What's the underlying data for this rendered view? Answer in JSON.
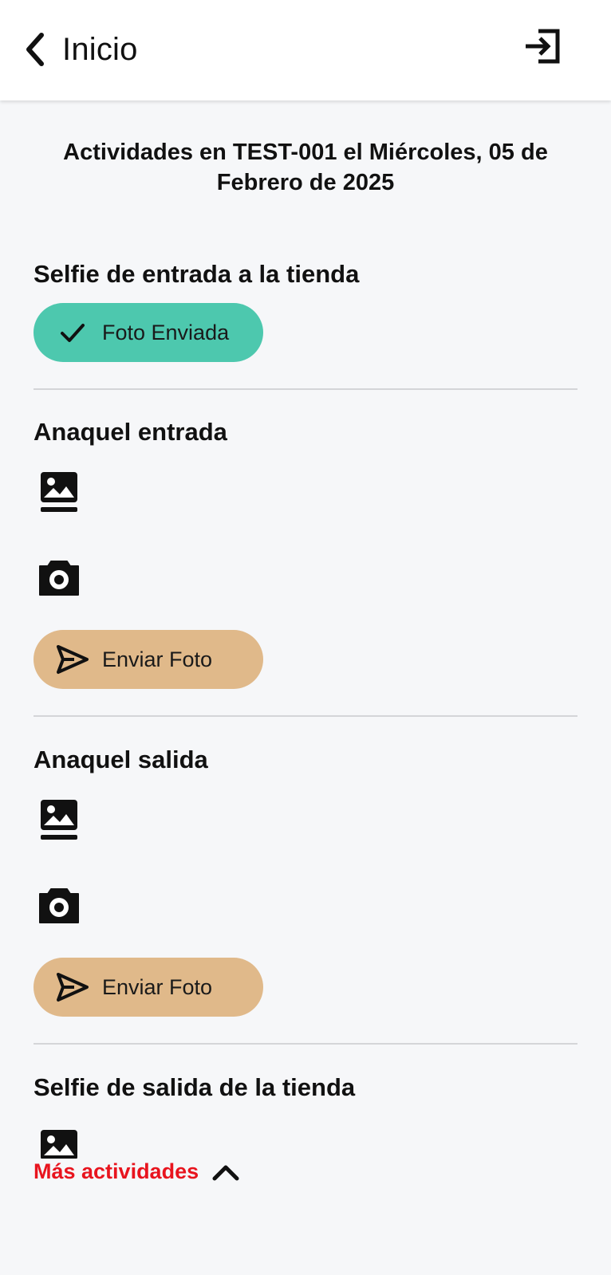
{
  "header": {
    "title": "Inicio",
    "back_icon": "chevron-left-icon",
    "logout_icon": "login-arrow-icon"
  },
  "heading": "Actividades en TEST-001 el Miércoles, 05 de Febrero de 2025",
  "activities": [
    {
      "title": "Selfie de entrada a la tienda",
      "status_button": {
        "label": "Foto Enviada",
        "icon": "check-icon",
        "color": "#4dc8ae"
      }
    },
    {
      "title": "Anaquel entrada",
      "gallery_icon": "gallery-icon",
      "camera_icon": "camera-icon",
      "send_button": {
        "label": "Enviar Foto",
        "icon": "send-icon",
        "color": "#e0b98a"
      }
    },
    {
      "title": "Anaquel salida",
      "gallery_icon": "gallery-icon",
      "camera_icon": "camera-icon",
      "send_button": {
        "label": "Enviar Foto",
        "icon": "send-icon",
        "color": "#e0b98a"
      }
    },
    {
      "title": "Selfie de salida de la tienda",
      "gallery_icon": "gallery-icon"
    }
  ],
  "more": {
    "label": "Más actividades",
    "icon": "chevron-up-icon",
    "color": "#e8141e"
  }
}
